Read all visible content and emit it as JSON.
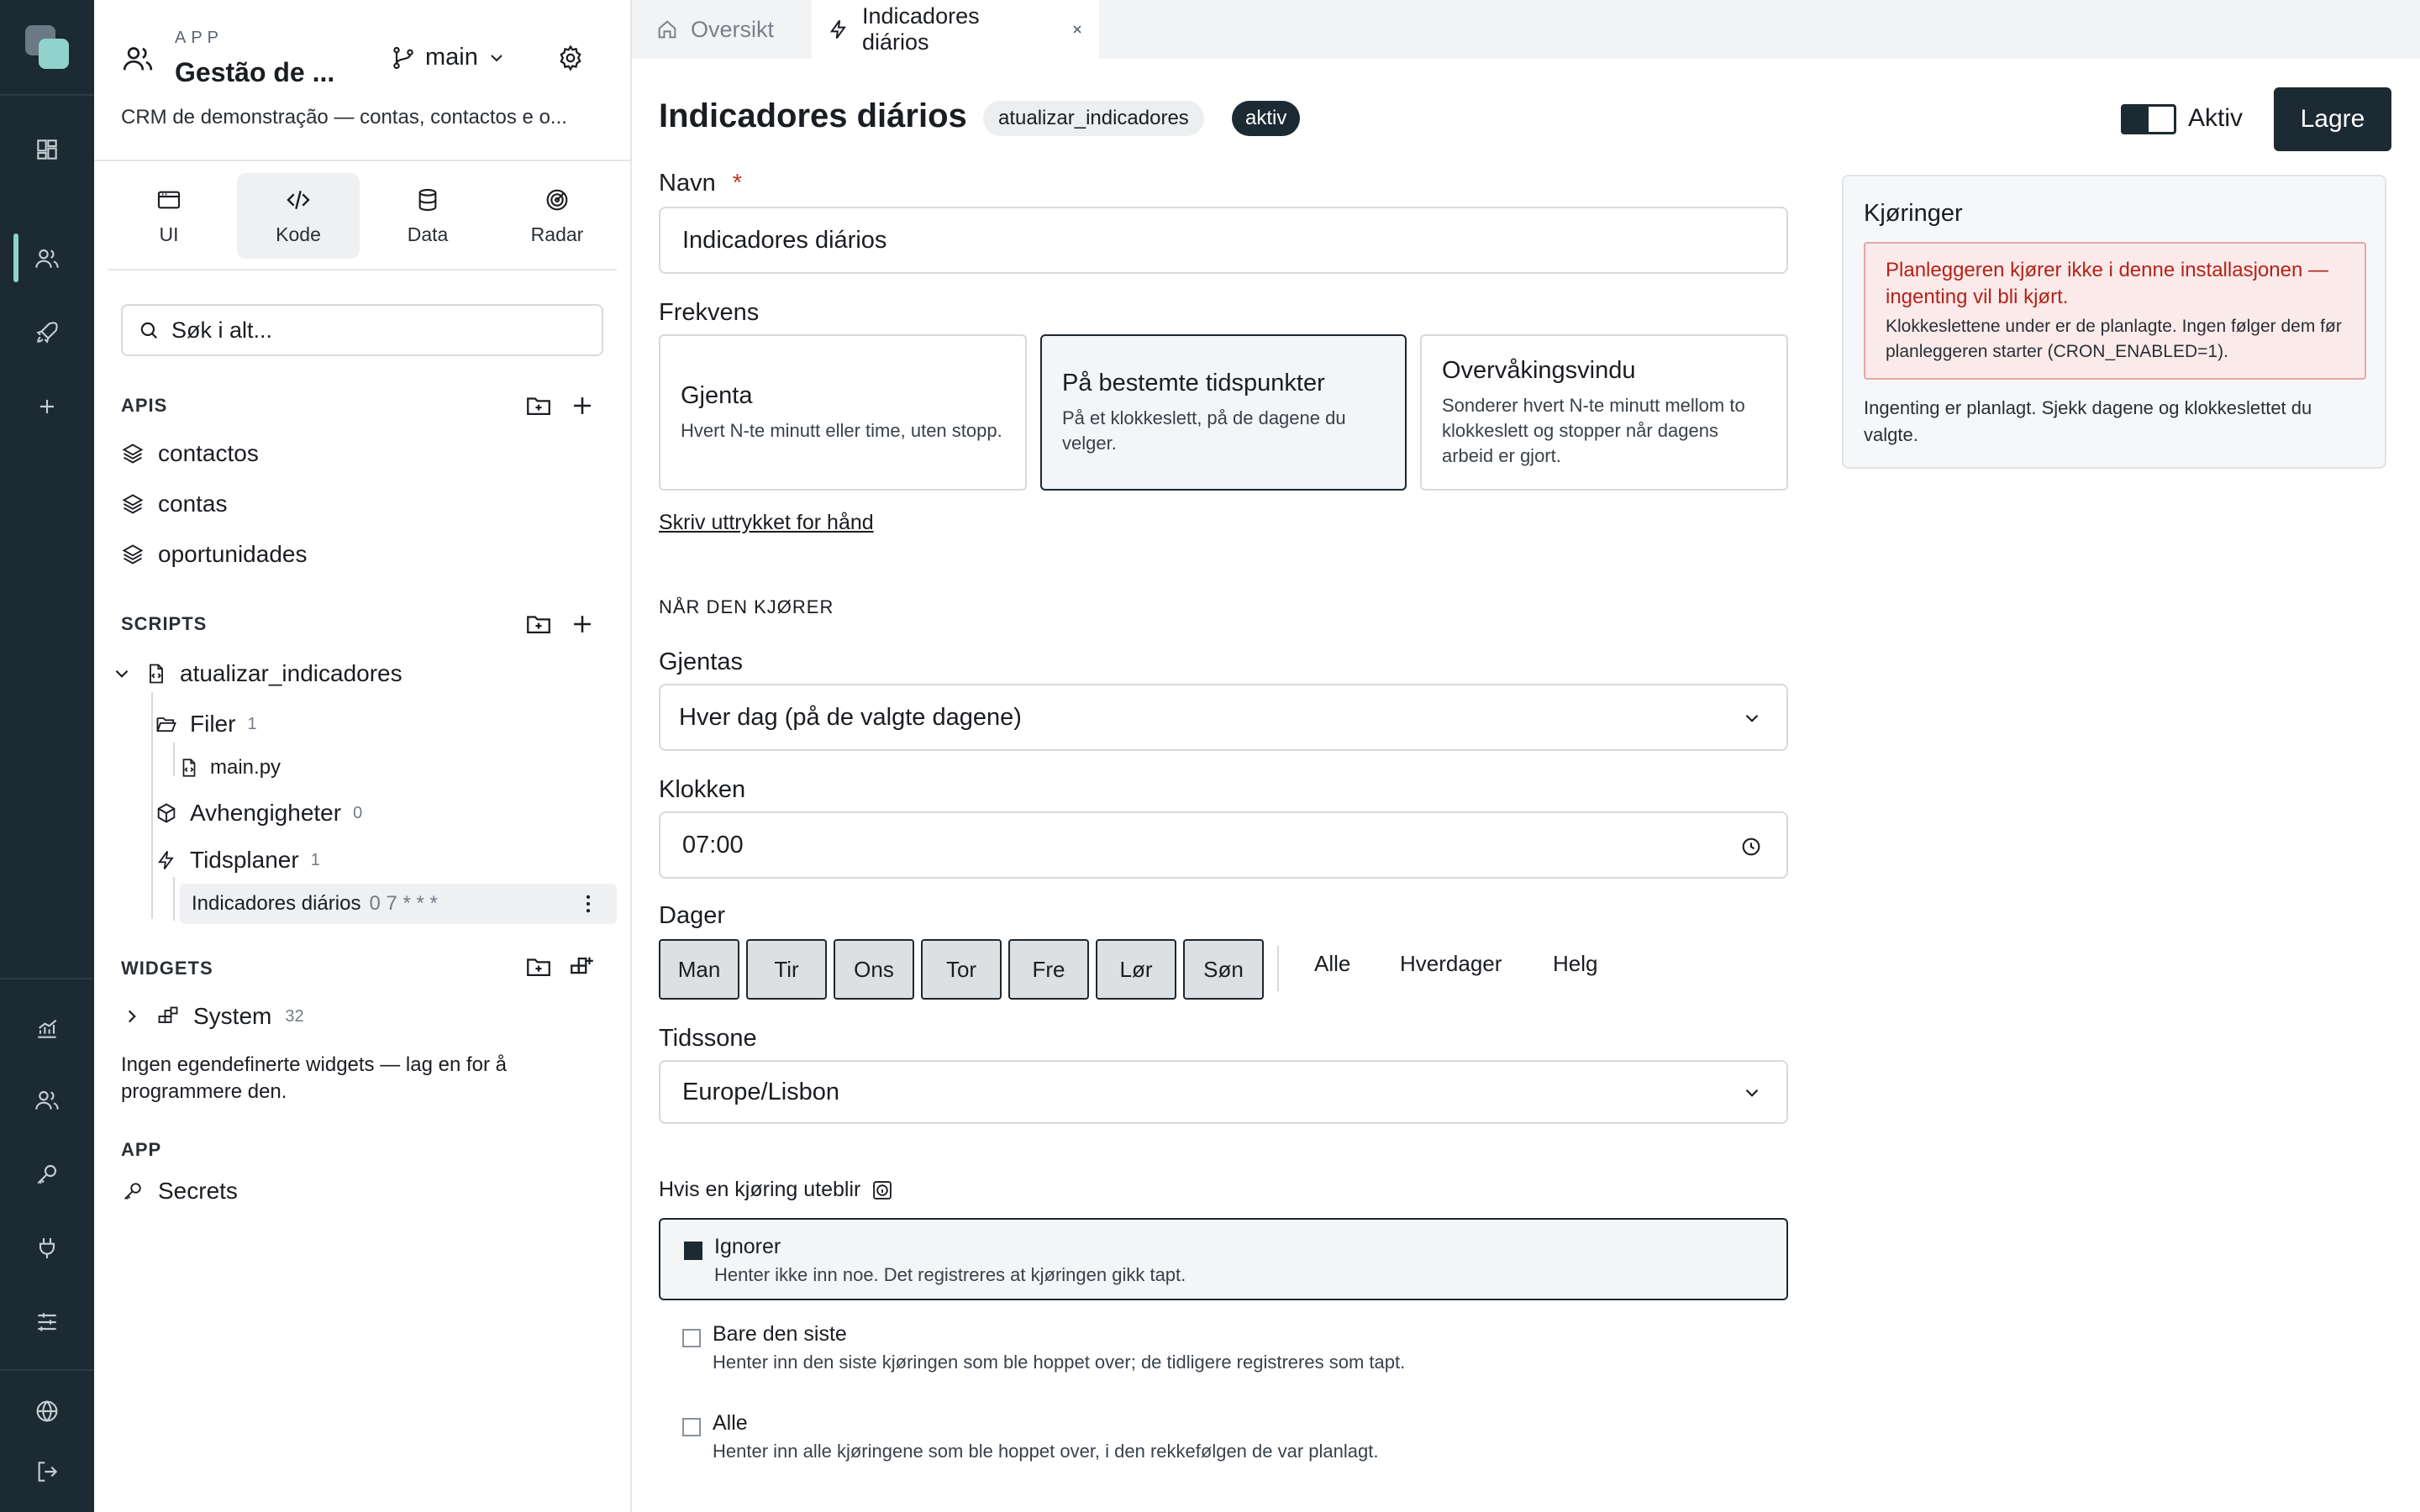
{
  "rail": {
    "items": [
      "dashboard-icon",
      "users-icon",
      "rocket-icon",
      "plus-icon",
      "chart-icon",
      "users-icon",
      "key-icon",
      "plug-icon",
      "sliders-icon",
      "globe-icon",
      "logout-icon"
    ],
    "colors": {
      "background": "#1c2a33",
      "active_accent": "#8fd3cc"
    }
  },
  "sidebar": {
    "app_label": "APP",
    "app_title": "Gestão de ...",
    "branch": "main",
    "description": "CRM de demonstração — contas, contactos e o...",
    "segments": [
      {
        "label": "UI",
        "icon": "window-icon"
      },
      {
        "label": "Kode",
        "icon": "code-icon"
      },
      {
        "label": "Data",
        "icon": "database-icon"
      },
      {
        "label": "Radar",
        "icon": "radar-icon"
      }
    ],
    "active_segment": "Kode",
    "search_placeholder": "Søk i alt...",
    "apis": {
      "title": "APIS",
      "items": [
        "contactos",
        "contas",
        "oportunidades"
      ]
    },
    "scripts": {
      "title": "SCRIPTS",
      "script_name": "atualizar_indicadores",
      "files_label": "Filer",
      "files_count": "1",
      "file_name": "main.py",
      "deps_label": "Avhengigheter",
      "deps_count": "0",
      "schedules_label": "Tidsplaner",
      "schedules_count": "1",
      "schedule_name": "Indicadores diários",
      "schedule_cron": "0 7 * * *"
    },
    "widgets": {
      "title": "WIDGETS",
      "group_name": "System",
      "group_count": "32",
      "empty_text": "Ingen egendefinerte widgets — lag en for å programmere den."
    },
    "app_section": {
      "title": "APP",
      "secrets_label": "Secrets"
    }
  },
  "tabs": [
    {
      "label": "Oversikt",
      "icon": "home-icon",
      "active": false
    },
    {
      "label": "Indicadores diários",
      "icon": "bolt-icon",
      "active": true
    }
  ],
  "main": {
    "title": "Indicadores diários",
    "script_pill": "atualizar_indicadores",
    "status_pill": "aktiv",
    "active_toggle_label": "Aktiv",
    "active_toggle_on": true,
    "save_label": "Lagre",
    "name_label": "Navn",
    "required_mark": "*",
    "name_value": "Indicadores diários",
    "frequency_label": "Frekvens",
    "frequency_options": [
      {
        "title": "Gjenta",
        "desc": "Hvert N-te minutt eller time, uten stopp."
      },
      {
        "title": "På bestemte tidspunkter",
        "desc": "På et klokkeslett, på de dagene du velger."
      },
      {
        "title": "Overvåkingsvindu",
        "desc": "Sonderer hvert N-te minutt mellom to klokkeslett og stopper når dagens arbeid er gjort."
      }
    ],
    "selected_frequency": "På bestemte tidspunkter",
    "manual_link": "Skriv uttrykket for hånd",
    "when_runs_heading": "NÅR DEN KJØRER",
    "repeat_label": "Gjentas",
    "repeat_value": "Hver dag (på de valgte dagene)",
    "time_label": "Klokken",
    "time_value": "07:00",
    "days_label": "Dager",
    "days": [
      "Man",
      "Tir",
      "Ons",
      "Tor",
      "Fre",
      "Lør",
      "Søn"
    ],
    "day_shortcuts": [
      "Alle",
      "Hverdager",
      "Helg"
    ],
    "timezone_label": "Tidssone",
    "timezone_value": "Europe/Lisbon",
    "missed_label": "Hvis en kjøring uteblir",
    "missed_options": [
      {
        "title": "Ignorer",
        "desc": "Henter ikke inn noe. Det registreres at kjøringen gikk tapt.",
        "selected": true
      },
      {
        "title": "Bare den siste",
        "desc": "Henter inn den siste kjøringen som ble hoppet over; de tidligere registreres som tapt.",
        "selected": false
      },
      {
        "title": "Alle",
        "desc": "Henter inn alle kjøringene som ble hoppet over, i den rekkefølgen de var planlagt.",
        "selected": false
      }
    ]
  },
  "runs_panel": {
    "title": "Kjøringer",
    "alert_title": "Planleggeren kjører ikke i denne installasjonen — ingenting vil bli kjørt.",
    "alert_body": "Klokkeslettene under er de planlagte. Ingen følger dem før planleggeren starter (CRON_ENABLED=1).",
    "empty_text": "Ingenting er planlagt. Sjekk dagene og klokkeslettet du valgte.",
    "colors": {
      "alert_text": "#b42318",
      "alert_bg": "#fbeaea",
      "alert_border": "#e8a6a6"
    }
  }
}
